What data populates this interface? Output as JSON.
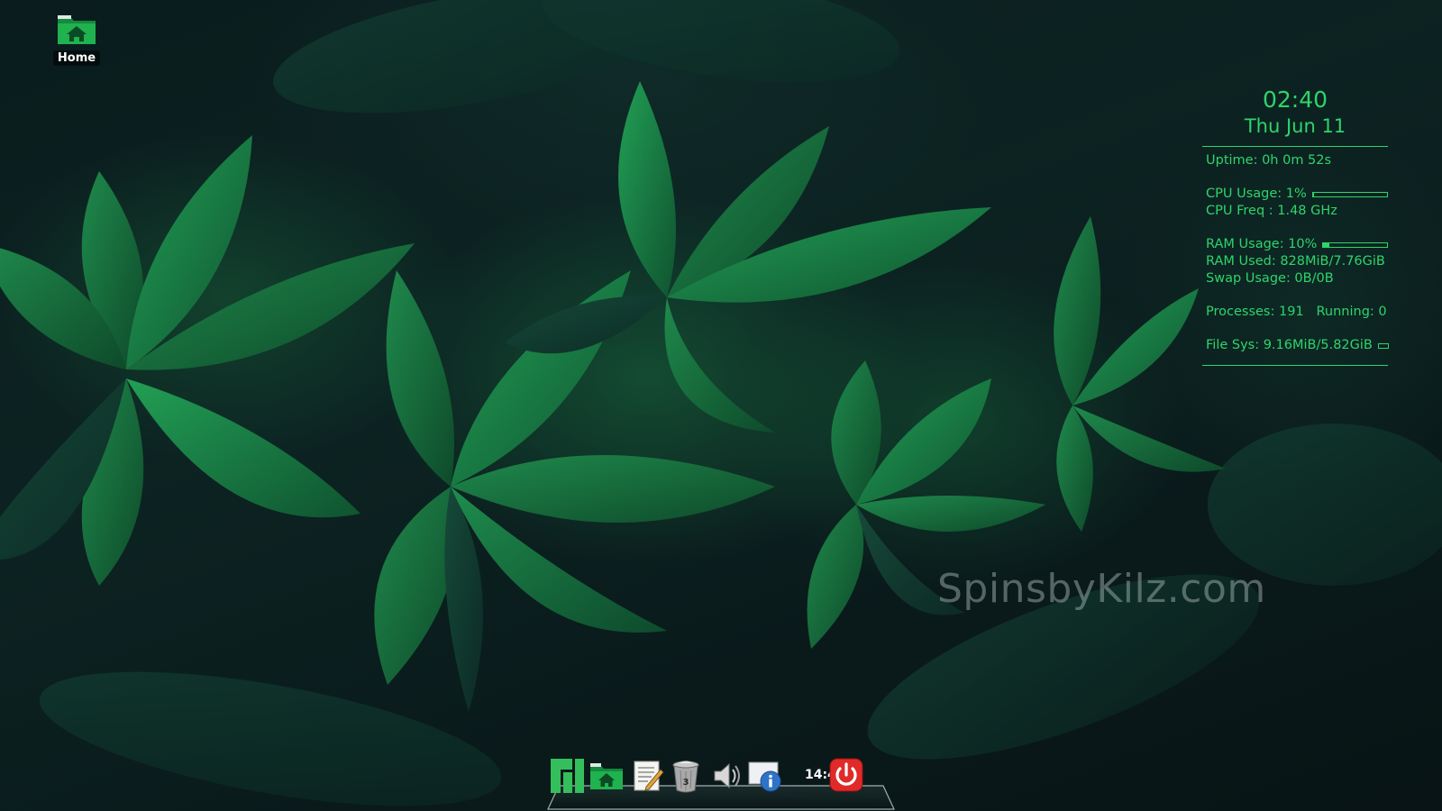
{
  "desktop": {
    "icons": [
      {
        "label": "Home",
        "icon": "home-folder-icon"
      }
    ],
    "watermark": "SpinsbyKilz.com"
  },
  "conky": {
    "time": "02:40",
    "date": "Thu Jun 11",
    "uptime": "Uptime: 0h 0m 52s",
    "cpu_usage": "CPU Usage: 1%",
    "cpu_usage_percent": 1,
    "cpu_freq": "CPU Freq : 1.48 GHz",
    "ram_usage": "RAM Usage: 10%",
    "ram_usage_percent": 10,
    "ram_used": "RAM Used: 828MiB/7.76GiB",
    "swap_usage": "Swap Usage: 0B/0B",
    "processes": "Processes: 191",
    "running": "Running: 0",
    "file_sys": "File Sys: 9.16MiB/5.82GiB",
    "color": "#2fd46b"
  },
  "dock": {
    "items": [
      {
        "name": "manjaro-menu",
        "icon": "manjaro-logo-icon"
      },
      {
        "name": "home-folder",
        "icon": "home-folder-icon"
      },
      {
        "name": "text-editor",
        "icon": "text-editor-icon"
      },
      {
        "name": "trash",
        "icon": "trash-icon"
      },
      {
        "name": "volume",
        "icon": "speaker-icon"
      },
      {
        "name": "system-info",
        "icon": "info-icon"
      },
      {
        "name": "power",
        "icon": "power-icon"
      }
    ],
    "clock": "14:40",
    "trash_count": "3"
  }
}
